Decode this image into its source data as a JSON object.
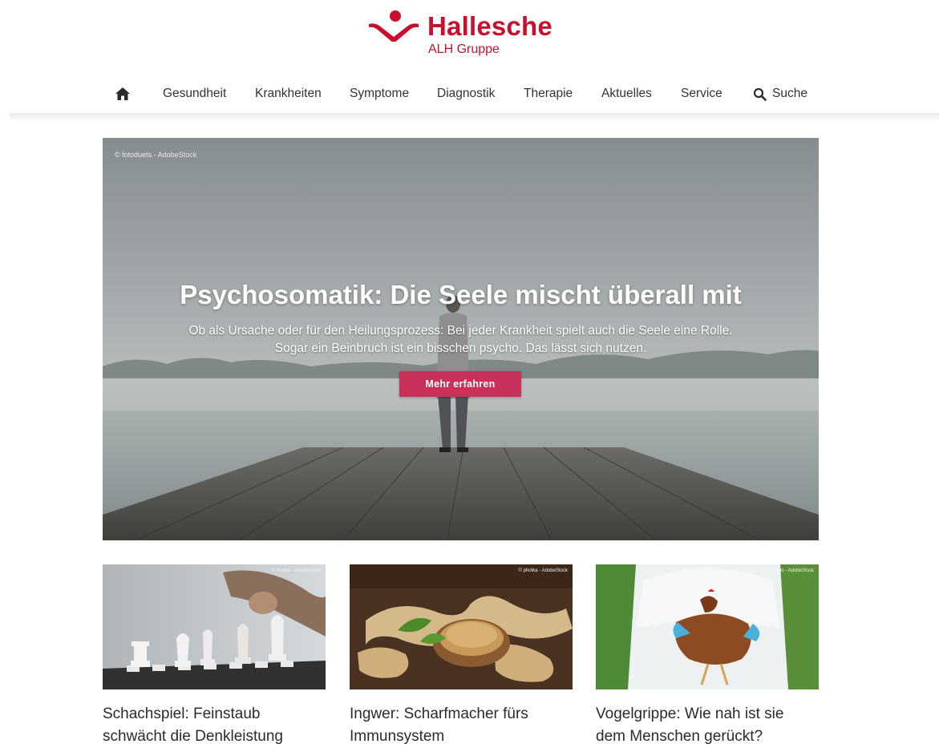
{
  "brand": {
    "name": "Hallesche",
    "group": "ALH Gruppe",
    "color": "#c8102e"
  },
  "nav": {
    "home_icon": "home-icon",
    "items": [
      "Gesundheit",
      "Krankheiten",
      "Symptome",
      "Diagnostik",
      "Therapie",
      "Aktuelles",
      "Service"
    ],
    "search_icon": "search-icon",
    "search_label": "Suche"
  },
  "hero": {
    "credit": "© fotoduets - AdobeStock",
    "title": "Psychosomatik: Die Seele mischt überall mit",
    "subtitle_line1": "Ob als Ursache oder für den Heilungsprozess: Bei jeder Krankheit spielt auch die Seele eine Rolle.",
    "subtitle_line2": "Sogar ein Beinbruch ist ein bisschen psycho. Das lässt sich nutzen.",
    "button_label": "Mehr erfahren",
    "button_color": "#c8325a"
  },
  "cards": [
    {
      "credit": "© maybe - AdobeStock",
      "title_line1": "Schachspiel: Feinstaub",
      "title_line2": "schwächt die Denkleistung"
    },
    {
      "credit": "© photka - AdobeStock",
      "title_line1": "Ingwer: Scharfmacher fürs",
      "title_line2": "Immunsystem"
    },
    {
      "credit": "© lanksodio - AdobeStock",
      "title_line1": "Vogelgrippe: Wie nah ist sie",
      "title_line2": "dem Menschen gerückt?"
    }
  ]
}
